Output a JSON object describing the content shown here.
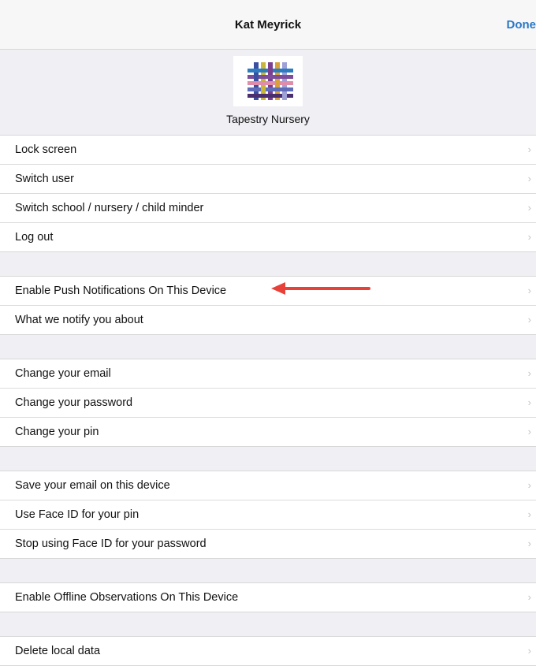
{
  "navbar": {
    "title": "Kat Meyrick",
    "done_label": "Done"
  },
  "header": {
    "org_name": "Tapestry Nursery",
    "logo_icon": "tapestry-weave-logo"
  },
  "chevron": "›",
  "groups": [
    [
      "Lock screen",
      "Switch user",
      "Switch school / nursery / child minder",
      "Log out"
    ],
    [
      "Enable Push Notifications On This Device",
      "What we notify you about"
    ],
    [
      "Change your email",
      "Change your password",
      "Change your pin"
    ],
    [
      "Save your email on this device",
      "Use Face ID for your pin",
      "Stop using Face ID for your password"
    ],
    [
      "Enable Offline Observations On This Device"
    ],
    [
      "Delete local data"
    ]
  ],
  "colors": {
    "accent": "#2a78c7",
    "arrow": "#e8413a",
    "background": "#efeff4"
  }
}
